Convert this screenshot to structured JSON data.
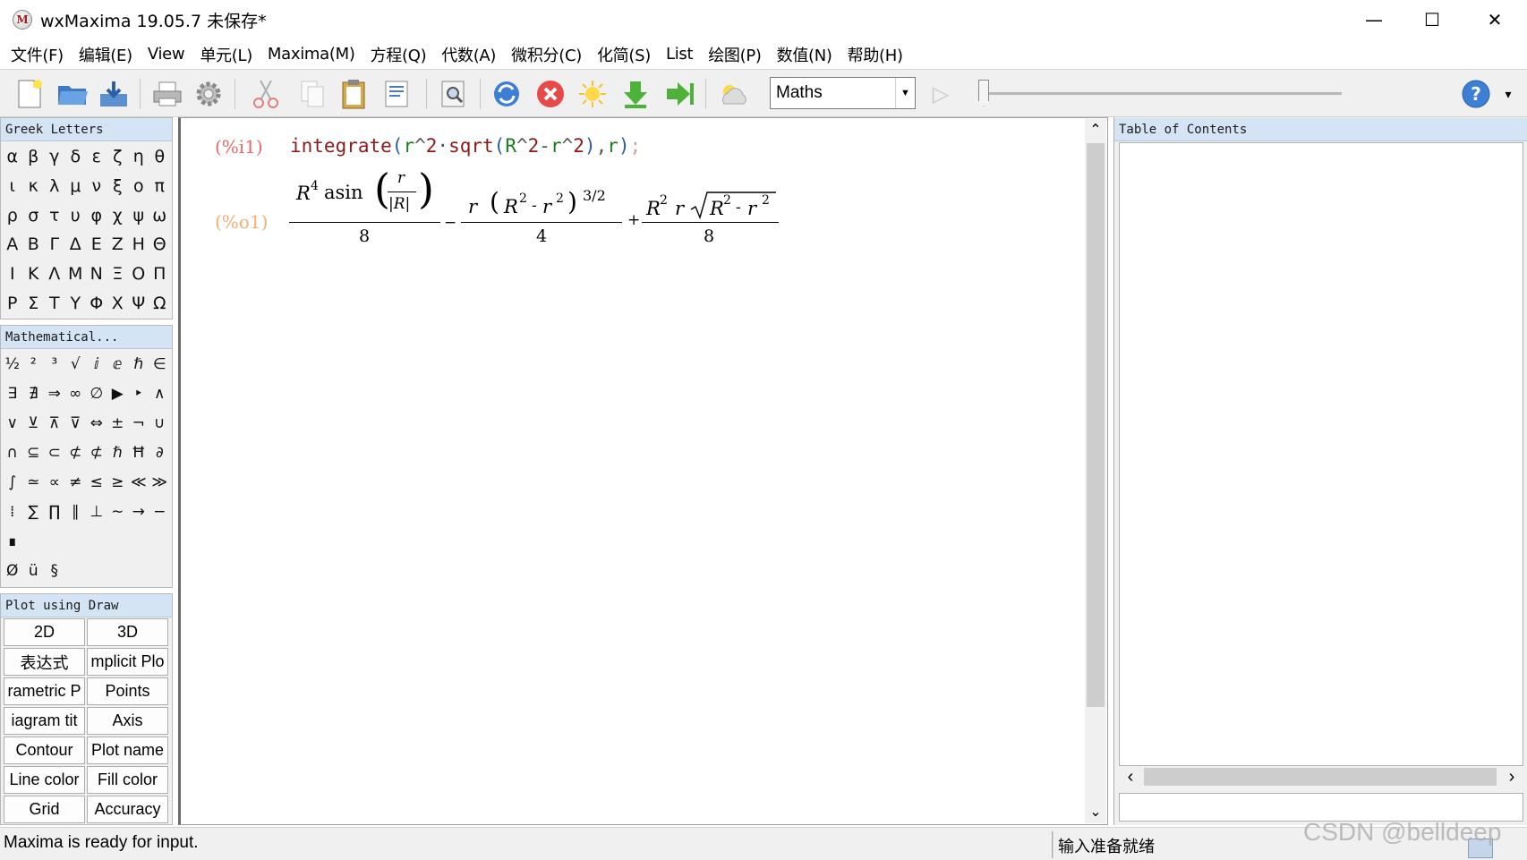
{
  "window": {
    "title": "wxMaxima 19.05.7 未保存*",
    "minimize": "—",
    "maximize": "☐",
    "close": "✕",
    "icon_letter": "M"
  },
  "menu": [
    "文件(F)",
    "编辑(E)",
    "View",
    "单元(L)",
    "Maxima(M)",
    "方程(Q)",
    "代数(A)",
    "微积分(C)",
    "化简(S)",
    "List",
    "绘图(P)",
    "数值(N)",
    "帮助(H)"
  ],
  "toolbar": {
    "icons": [
      "new-file-icon",
      "open-folder-icon",
      "save-icon",
      "print-icon",
      "settings-gear-icon",
      "cut-icon",
      "copy-icon",
      "paste-icon",
      "select-all-icon",
      "find-icon",
      "restart-icon",
      "interrupt-icon",
      "follow-icon",
      "evaluate-icon",
      "evaluate-all-icon",
      "evaluate-tillhere-icon"
    ],
    "style_select": "Maths",
    "help_icon": "?",
    "more_icon": "▾",
    "play_icon": "▷"
  },
  "greek": {
    "title": "Greek Letters",
    "symbols": [
      "α",
      "β",
      "γ",
      "δ",
      "ε",
      "ζ",
      "η",
      "θ",
      "ι",
      "κ",
      "λ",
      "μ",
      "ν",
      "ξ",
      "ο",
      "π",
      "ρ",
      "σ",
      "τ",
      "υ",
      "φ",
      "χ",
      "ψ",
      "ω",
      "Α",
      "Β",
      "Γ",
      "Δ",
      "Ε",
      "Ζ",
      "Η",
      "Θ",
      "Ι",
      "Κ",
      "Λ",
      "Μ",
      "Ν",
      "Ξ",
      "Ο",
      "Π",
      "Ρ",
      "Σ",
      "Τ",
      "Υ",
      "Φ",
      "Χ",
      "Ψ",
      "Ω"
    ]
  },
  "math_symbols": {
    "title": "Mathematical...",
    "symbols": [
      "½",
      "²",
      "³",
      "√",
      "ⅈ",
      "ⅇ",
      "ℏ",
      "∈",
      "∃",
      "∄",
      "⇒",
      "∞",
      "∅",
      "▶",
      "‣",
      "∧",
      "∨",
      "⊻",
      "⊼",
      "⊽",
      "⇔",
      "±",
      "¬",
      "∪",
      "∩",
      "⊆",
      "⊂",
      "⊄",
      "⊄",
      "ℏ",
      "Ħ",
      "∂",
      "∫",
      "≃",
      "∝",
      "≠",
      "≤",
      "≥",
      "≪",
      "≫",
      "⁞",
      "∑",
      "∏",
      "∥",
      "⊥",
      "∼",
      "→",
      "−",
      "∎",
      "",
      "",
      "",
      "",
      "",
      "",
      "",
      "Ø",
      "ü",
      "§"
    ]
  },
  "draw": {
    "title": "Plot using Draw",
    "buttons": [
      "2D",
      "3D",
      "表达式",
      "mplicit Plo",
      "rametric P",
      "Points",
      "iagram tit",
      "Axis",
      "Contour",
      "Plot name",
      "Line color",
      "Fill color",
      "Grid",
      "Accuracy"
    ]
  },
  "worksheet": {
    "input_label": "(%i1)",
    "input_tokens": [
      {
        "t": "integrate",
        "c": "#8b1a1a"
      },
      {
        "t": "(",
        "c": "#2a5d9f"
      },
      {
        "t": "r",
        "c": "#1e7a1e"
      },
      {
        "t": "^",
        "c": "#555555"
      },
      {
        "t": "2",
        "c": "#8b1a1a"
      },
      {
        "t": "·",
        "c": "#555555"
      },
      {
        "t": "sqrt",
        "c": "#8b1a1a"
      },
      {
        "t": "(",
        "c": "#2a5d9f"
      },
      {
        "t": "R",
        "c": "#1e7a1e"
      },
      {
        "t": "^",
        "c": "#555555"
      },
      {
        "t": "2",
        "c": "#8b1a1a"
      },
      {
        "t": "-",
        "c": "#555555"
      },
      {
        "t": "r",
        "c": "#1e7a1e"
      },
      {
        "t": "^",
        "c": "#555555"
      },
      {
        "t": "2",
        "c": "#8b1a1a"
      },
      {
        "t": ")",
        "c": "#2a5d9f"
      },
      {
        "t": ",",
        "c": "#555555"
      },
      {
        "t": "r",
        "c": "#1e7a1e"
      },
      {
        "t": ")",
        "c": "#2a5d9f"
      },
      {
        "t": ";",
        "c": "#d0a0a0"
      }
    ],
    "output_label": "(%o1)",
    "output": {
      "t1": {
        "R": "R",
        "exp4": "4",
        "fn": "asin",
        "frac_num": "r",
        "frac_den": "|R|",
        "den": "8"
      },
      "op1": "−",
      "t2": {
        "r": "r",
        "R": "R",
        "exp2a": "2",
        "minus": "-",
        "r2": "r",
        "exp2b": "2",
        "pow": "3/2",
        "den": "4"
      },
      "op2": "+",
      "t3": {
        "R": "R",
        "exp2": "2",
        "r": "r",
        "sqrt_R": "R",
        "exp2a": "2",
        "minus": "-",
        "sqrt_r": "r",
        "exp2b": "2",
        "den": "8"
      }
    }
  },
  "scroll": {
    "up": "⌃",
    "down": "⌄",
    "left": "‹",
    "right": "›"
  },
  "toc": {
    "title": "Table of Contents"
  },
  "status": {
    "left": "Maxima is ready for input.",
    "right": "输入准备就绪"
  },
  "watermark": "CSDN @belldeep",
  "colors": {
    "input_label": "#e86a6a",
    "output_label": "#f0b070",
    "panel_title_bg": "#d4e4f5"
  }
}
